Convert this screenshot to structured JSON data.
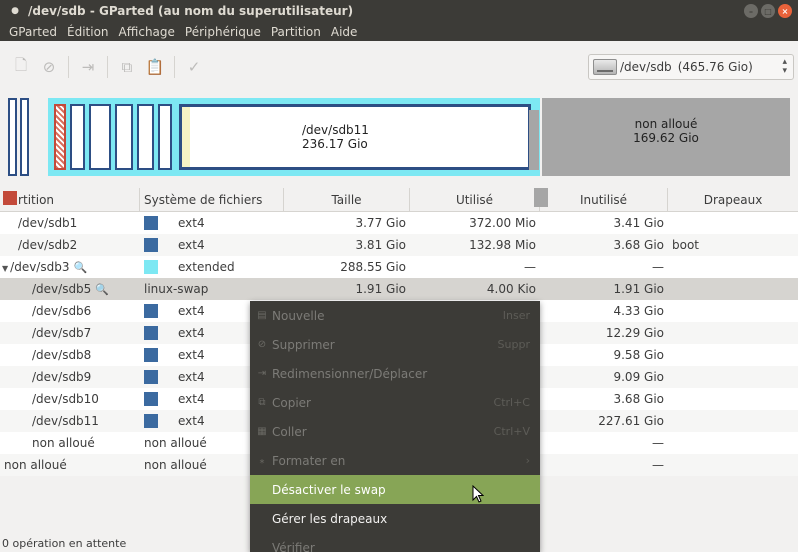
{
  "window": {
    "title": "/dev/sdb - GParted (au nom du superutilisateur)",
    "controls": [
      "–",
      "□",
      "×"
    ]
  },
  "menubar": [
    "GParted",
    "Édition",
    "Affichage",
    "Périphérique",
    "Partition",
    "Aide"
  ],
  "toolbar": {
    "icons": [
      "new-icon",
      "delete-icon",
      "resize-icon",
      "copy-icon",
      "paste-icon",
      "apply-icon"
    ],
    "device": {
      "name": "/dev/sdb",
      "size": "(465.76 Gio)"
    }
  },
  "graph": {
    "main_label": "/dev/sdb11",
    "main_size": "236.17 Gio",
    "unalloc_label": "non alloué",
    "unalloc_size": "169.62 Gio"
  },
  "table": {
    "headers": [
      "Partition",
      "Système de fichiers",
      "Taille",
      "Utilisé",
      "Inutilisé",
      "Drapeaux"
    ],
    "rows": [
      {
        "partition": "/dev/sdb1",
        "fs": "ext4",
        "fsclass": "ext4",
        "size": "3.77 Gio",
        "used": "372.00 Mio",
        "unused": "3.41 Gio",
        "flags": ""
      },
      {
        "partition": "/dev/sdb2",
        "fs": "ext4",
        "fsclass": "ext4",
        "size": "3.81 Gio",
        "used": "132.98 Mio",
        "unused": "3.68 Gio",
        "flags": "boot"
      },
      {
        "partition": "/dev/sdb3",
        "fs": "extended",
        "fsclass": "extended",
        "size": "288.55 Gio",
        "used": "—",
        "unused": "—",
        "flags": ""
      },
      {
        "partition": "/dev/sdb5",
        "fs": "linux-swap",
        "fsclass": "swap",
        "size": "1.91 Gio",
        "used": "4.00 Kio",
        "unused": "1.91 Gio",
        "flags": ""
      },
      {
        "partition": "/dev/sdb6",
        "fs": "ext4",
        "fsclass": "ext4",
        "size": "",
        "used": "",
        "unused": "4.33 Gio",
        "flags": ""
      },
      {
        "partition": "/dev/sdb7",
        "fs": "ext4",
        "fsclass": "ext4",
        "size": "",
        "used": "",
        "unused": "12.29 Gio",
        "flags": ""
      },
      {
        "partition": "/dev/sdb8",
        "fs": "ext4",
        "fsclass": "ext4",
        "size": "",
        "used": "",
        "unused": "9.58 Gio",
        "flags": ""
      },
      {
        "partition": "/dev/sdb9",
        "fs": "ext4",
        "fsclass": "ext4",
        "size": "",
        "used": "",
        "unused": "9.09 Gio",
        "flags": ""
      },
      {
        "partition": "/dev/sdb10",
        "fs": "ext4",
        "fsclass": "ext4",
        "size": "",
        "used": "",
        "unused": "3.68 Gio",
        "flags": ""
      },
      {
        "partition": "/dev/sdb11",
        "fs": "ext4",
        "fsclass": "ext4",
        "size": "",
        "used": "",
        "unused": "227.61 Gio",
        "flags": ""
      },
      {
        "partition": "non alloué",
        "fs": "non alloué",
        "fsclass": "unalloc",
        "size": "",
        "used": "",
        "unused": "—",
        "flags": ""
      },
      {
        "partition": "non alloué",
        "fs": "non alloué",
        "fsclass": "unalloc",
        "size": "",
        "used": "",
        "unused": "—",
        "flags": ""
      }
    ]
  },
  "context_menu": {
    "items": [
      {
        "label": "Nouvelle",
        "accel": "Inser",
        "icon": "new-icon",
        "enabled": false
      },
      {
        "label": "Supprimer",
        "accel": "Suppr",
        "icon": "delete-icon",
        "enabled": false
      },
      {
        "label": "Redimensionner/Déplacer",
        "accel": "",
        "icon": "resize-icon",
        "enabled": false
      },
      {
        "label": "Copier",
        "accel": "Ctrl+C",
        "icon": "copy-icon",
        "enabled": false
      },
      {
        "label": "Coller",
        "accel": "Ctrl+V",
        "icon": "paste-icon",
        "enabled": false
      },
      {
        "label": "Formater en",
        "accel": "›",
        "icon": "format-icon",
        "enabled": false
      },
      {
        "label": "Désactiver le swap",
        "accel": "",
        "icon": "",
        "enabled": true,
        "highlighted": true
      },
      {
        "label": "Gérer les drapeaux",
        "accel": "",
        "icon": "",
        "enabled": true
      },
      {
        "label": "Vérifier",
        "accel": "",
        "icon": "",
        "enabled": false
      }
    ]
  },
  "status": "0 opération en attente",
  "colors": {
    "ext4": "#3b6aa0",
    "extended": "#7de8f3",
    "swap": "#c34a3a",
    "unalloc": "#a6a6a6",
    "highlight": "#87a556"
  }
}
